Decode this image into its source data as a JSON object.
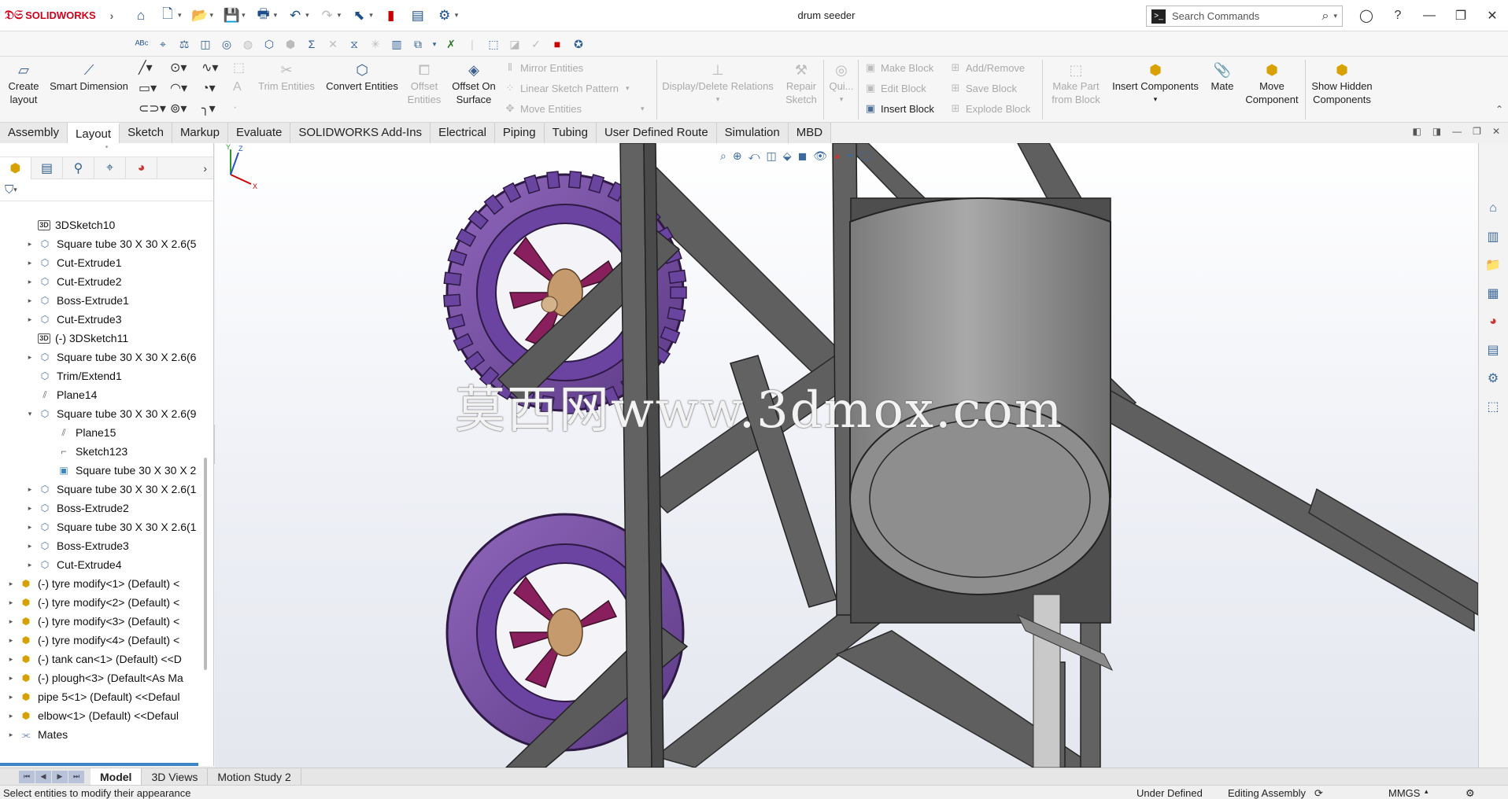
{
  "app": {
    "brand": "SOLIDWORKS",
    "document_title": "drum seeder",
    "search_placeholder": "Search Commands"
  },
  "ribbon": {
    "create_layout": [
      "Create",
      "layout"
    ],
    "smart_dimension": "Smart Dimension",
    "trim_entities": "Trim Entities",
    "convert_entities": "Convert Entities",
    "offset_entities": [
      "Offset",
      "Entities"
    ],
    "offset_on_surface": [
      "Offset On",
      "Surface"
    ],
    "mirror_entities": "Mirror Entities",
    "linear_sketch_pattern": "Linear Sketch Pattern",
    "move_entities": "Move Entities",
    "display_delete_relations": "Display/Delete Relations",
    "repair_sketch": [
      "Repair",
      "Sketch"
    ],
    "quick": "Qui...",
    "make_block": "Make Block",
    "edit_block": "Edit Block",
    "insert_block": "Insert Block",
    "add_remove": "Add/Remove",
    "save_block": "Save Block",
    "explode_block": "Explode Block",
    "make_part_from_block": [
      "Make Part",
      "from Block"
    ],
    "insert_components": "Insert Components",
    "mate": "Mate",
    "move_component": [
      "Move",
      "Component"
    ],
    "show_hidden_components": [
      "Show Hidden",
      "Components"
    ]
  },
  "tabs": [
    "Assembly",
    "Layout",
    "Sketch",
    "Markup",
    "Evaluate",
    "SOLIDWORKS Add-Ins",
    "Electrical",
    "Piping",
    "Tubing",
    "User Defined Route",
    "Simulation",
    "MBD"
  ],
  "active_tab": "Layout",
  "tree": [
    {
      "label": "3DSketch10",
      "icon": "sketch3d",
      "expand": false,
      "indent": 1
    },
    {
      "label": "Square tube 30 X 30 X 2.6(5",
      "icon": "feature",
      "expand": true,
      "indent": 1
    },
    {
      "label": "Cut-Extrude1",
      "icon": "feature",
      "expand": true,
      "indent": 1
    },
    {
      "label": "Cut-Extrude2",
      "icon": "feature",
      "expand": true,
      "indent": 1
    },
    {
      "label": "Boss-Extrude1",
      "icon": "feature",
      "expand": true,
      "indent": 1
    },
    {
      "label": "Cut-Extrude3",
      "icon": "feature",
      "expand": true,
      "indent": 1
    },
    {
      "label": "(-) 3DSketch11",
      "icon": "sketch3d",
      "expand": false,
      "indent": 1
    },
    {
      "label": "Square tube 30 X 30 X 2.6(6",
      "icon": "feature",
      "expand": true,
      "indent": 1
    },
    {
      "label": "Trim/Extend1",
      "icon": "feature",
      "expand": false,
      "indent": 1
    },
    {
      "label": "Plane14",
      "icon": "plane",
      "expand": false,
      "indent": 1
    },
    {
      "label": "Square tube 30 X 30 X 2.6(9",
      "icon": "feature",
      "expand": "open",
      "indent": 1
    },
    {
      "label": "Plane15",
      "icon": "plane",
      "expand": false,
      "indent": 2
    },
    {
      "label": "Sketch123",
      "icon": "sketch",
      "expand": false,
      "indent": 2
    },
    {
      "label": "Square tube 30 X 30 X 2",
      "icon": "body",
      "expand": false,
      "indent": 2
    },
    {
      "label": "Square tube 30 X 30 X 2.6(1",
      "icon": "feature",
      "expand": true,
      "indent": 1
    },
    {
      "label": "Boss-Extrude2",
      "icon": "feature",
      "expand": true,
      "indent": 1
    },
    {
      "label": "Square tube 30 X 30 X 2.6(1",
      "icon": "feature",
      "expand": true,
      "indent": 1
    },
    {
      "label": "Boss-Extrude3",
      "icon": "feature",
      "expand": true,
      "indent": 1
    },
    {
      "label": "Cut-Extrude4",
      "icon": "feature",
      "expand": true,
      "indent": 1
    },
    {
      "label": "(-) tyre modify<1> (Default) <",
      "icon": "component",
      "expand": true,
      "indent": 0
    },
    {
      "label": "(-) tyre modify<2> (Default) <",
      "icon": "component",
      "expand": true,
      "indent": 0
    },
    {
      "label": "(-) tyre modify<3> (Default) <",
      "icon": "component",
      "expand": true,
      "indent": 0
    },
    {
      "label": "(-) tyre modify<4> (Default) <",
      "icon": "component",
      "expand": true,
      "indent": 0
    },
    {
      "label": "(-) tank can<1> (Default) <<D",
      "icon": "component",
      "expand": true,
      "indent": 0
    },
    {
      "label": "(-) plough<3> (Default<As Ma",
      "icon": "component",
      "expand": true,
      "indent": 0
    },
    {
      "label": "pipe 5<1> (Default) <<Defaul",
      "icon": "component",
      "expand": true,
      "indent": 0
    },
    {
      "label": "elbow<1> (Default) <<Defaul",
      "icon": "component",
      "expand": true,
      "indent": 0
    },
    {
      "label": "Mates",
      "icon": "mates",
      "expand": true,
      "indent": 0
    }
  ],
  "watermark": "莫西网www.3dmox.com",
  "triad": {
    "x": "X",
    "y": "Y",
    "z": "Z"
  },
  "bottom_tabs": [
    "Model",
    "3D Views",
    "Motion Study 2"
  ],
  "active_bottom_tab": "Model",
  "status": {
    "message": "Select entities to modify their appearance",
    "definition": "Under Defined",
    "mode": "Editing Assembly",
    "units": "MMGS"
  },
  "colors": {
    "brand_red": "#d0021b",
    "tyre_purple": "#7a4fa5",
    "rim_magenta": "#8a1f5e",
    "frame_gray": "#5a5a5a",
    "tank_gray": "#8c8c8c",
    "tree_highlight": "#3d86c6"
  }
}
